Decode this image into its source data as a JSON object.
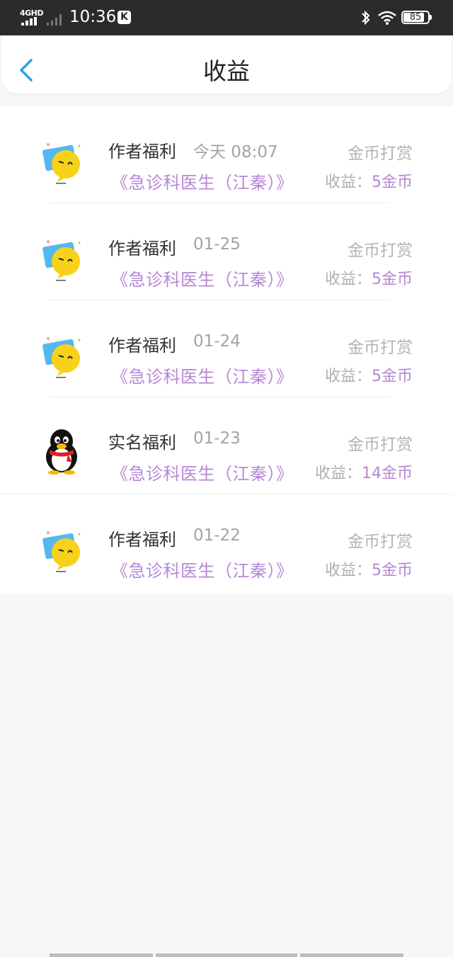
{
  "status_bar": {
    "network": "4GHD",
    "time": "10:36",
    "k_badge": "K",
    "battery": "85",
    "battery_level": 0.85
  },
  "header": {
    "back_icon": "chevron-left-icon",
    "title": "收益"
  },
  "records": [
    {
      "avatar": "emoji-avatar",
      "type": "作者福利",
      "date": "今天 08:07",
      "source": "金币打赏",
      "book": "《急诊科医生（江秦）》",
      "earn_label": "收益：",
      "amount": "5金币"
    },
    {
      "avatar": "emoji-avatar",
      "type": "作者福利",
      "date": "01-25",
      "source": "金币打赏",
      "book": "《急诊科医生（江秦）》",
      "earn_label": "收益：",
      "amount": "5金币"
    },
    {
      "avatar": "emoji-avatar",
      "type": "作者福利",
      "date": "01-24",
      "source": "金币打赏",
      "book": "《急诊科医生（江秦）》",
      "earn_label": "收益：",
      "amount": "5金币"
    },
    {
      "avatar": "penguin-avatar",
      "type": "实名福利",
      "date": "01-23",
      "source": "金币打赏",
      "book": "《急诊科医生（江秦）》",
      "earn_label": "收益：",
      "amount": "14金币"
    },
    {
      "avatar": "emoji-avatar",
      "type": "作者福利",
      "date": "01-22",
      "source": "金币打赏",
      "book": "《急诊科医生（江秦）》",
      "earn_label": "收益：",
      "amount": "5金币"
    }
  ],
  "colors": {
    "accent_purple": "#b687d6",
    "back_blue": "#2aa0e8",
    "status_bar_bg": "#2b2b2b"
  }
}
